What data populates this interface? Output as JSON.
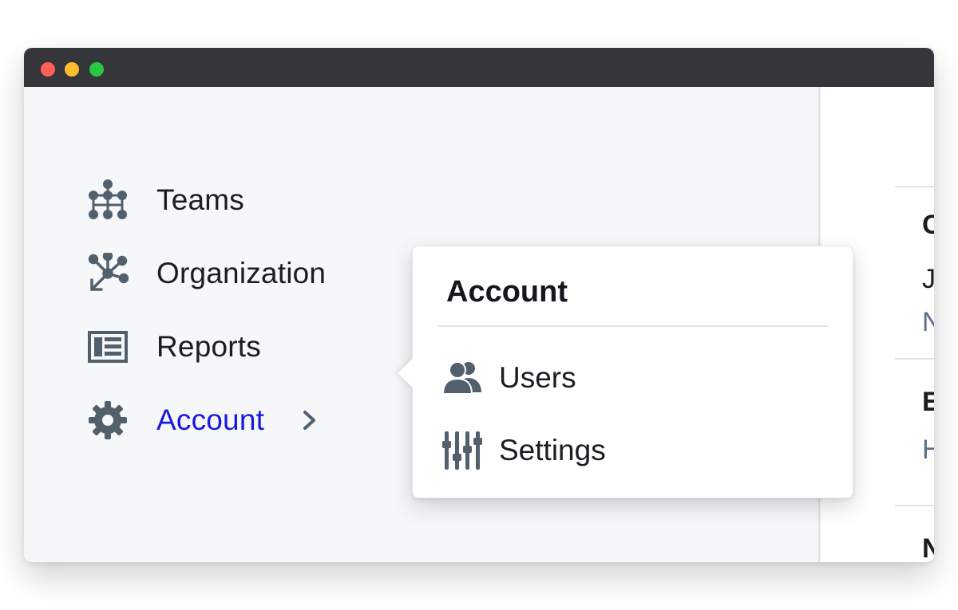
{
  "colors": {
    "accent": "#1a1adf",
    "icon": "#52606e",
    "titlebar": "#35363a",
    "sidebar_bg": "#f5f7f9"
  },
  "sidebar": {
    "items": [
      {
        "label": "Teams",
        "icon": "hierarchy-icon"
      },
      {
        "label": "Organization",
        "icon": "network-icon"
      },
      {
        "label": "Reports",
        "icon": "table-icon"
      },
      {
        "label": "Account",
        "icon": "gear-icon",
        "active": true
      }
    ]
  },
  "popover": {
    "title": "Account",
    "items": [
      {
        "label": "Users",
        "icon": "users-icon"
      },
      {
        "label": "Settings",
        "icon": "sliders-icon"
      }
    ]
  },
  "content": {
    "rows": [
      {
        "title": "C",
        "line1": "J",
        "line2": "N"
      },
      {
        "title": "E",
        "line2": "H"
      },
      {
        "title": "N"
      }
    ]
  }
}
